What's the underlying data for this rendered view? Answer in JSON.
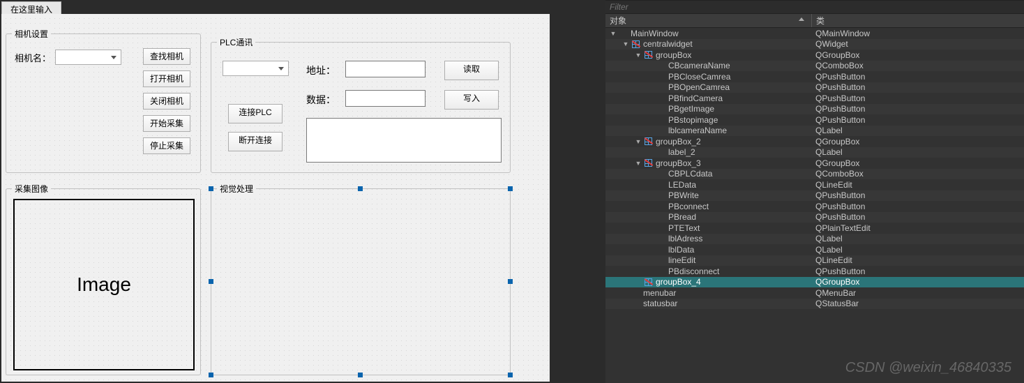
{
  "designer": {
    "tab_title": "在这里输入",
    "camera_group": {
      "title": "相机设置",
      "camera_name_label": "相机名：",
      "buttons": {
        "find": "查找相机",
        "open": "打开相机",
        "close": "关闭相机",
        "start": "开始采集",
        "stop": "停止采集"
      }
    },
    "plc_group": {
      "title": "PLC通讯",
      "connect": "连接PLC",
      "disconnect": "断开连接",
      "address_label": "地址：",
      "data_label": "数据：",
      "read": "读取",
      "write": "写入"
    },
    "image_group": {
      "title": "采集图像",
      "placeholder_text": "Image"
    },
    "vision_group": {
      "title": "视觉处理"
    }
  },
  "inspector": {
    "filter_placeholder": "Filter",
    "columns": {
      "object": "对象",
      "class": "类"
    },
    "tree": [
      {
        "depth": 0,
        "toggle": "▼",
        "icon": "none",
        "name": "MainWindow",
        "cls": "QMainWindow",
        "alt": false
      },
      {
        "depth": 1,
        "toggle": "▼",
        "icon": "layout-no",
        "name": "centralwidget",
        "cls": "QWidget",
        "alt": true
      },
      {
        "depth": 2,
        "toggle": "▼",
        "icon": "layout-no",
        "name": "groupBox",
        "cls": "QGroupBox",
        "alt": false
      },
      {
        "depth": 3,
        "toggle": "",
        "icon": "none",
        "name": "CBcameraName",
        "cls": "QComboBox",
        "alt": true
      },
      {
        "depth": 3,
        "toggle": "",
        "icon": "none",
        "name": "PBCloseCamrea",
        "cls": "QPushButton",
        "alt": false
      },
      {
        "depth": 3,
        "toggle": "",
        "icon": "none",
        "name": "PBOpenCamrea",
        "cls": "QPushButton",
        "alt": true
      },
      {
        "depth": 3,
        "toggle": "",
        "icon": "none",
        "name": "PBfindCamera",
        "cls": "QPushButton",
        "alt": false
      },
      {
        "depth": 3,
        "toggle": "",
        "icon": "none",
        "name": "PBgetImage",
        "cls": "QPushButton",
        "alt": true
      },
      {
        "depth": 3,
        "toggle": "",
        "icon": "none",
        "name": "PBstopimage",
        "cls": "QPushButton",
        "alt": false
      },
      {
        "depth": 3,
        "toggle": "",
        "icon": "none",
        "name": "lblcameraName",
        "cls": "QLabel",
        "alt": true
      },
      {
        "depth": 2,
        "toggle": "▼",
        "icon": "layout-no",
        "name": "groupBox_2",
        "cls": "QGroupBox",
        "alt": false
      },
      {
        "depth": 3,
        "toggle": "",
        "icon": "none",
        "name": "label_2",
        "cls": "QLabel",
        "alt": true
      },
      {
        "depth": 2,
        "toggle": "▼",
        "icon": "layout-no",
        "name": "groupBox_3",
        "cls": "QGroupBox",
        "alt": false
      },
      {
        "depth": 3,
        "toggle": "",
        "icon": "none",
        "name": "CBPLCdata",
        "cls": "QComboBox",
        "alt": true
      },
      {
        "depth": 3,
        "toggle": "",
        "icon": "none",
        "name": "LEData",
        "cls": "QLineEdit",
        "alt": false
      },
      {
        "depth": 3,
        "toggle": "",
        "icon": "none",
        "name": "PBWrite",
        "cls": "QPushButton",
        "alt": true
      },
      {
        "depth": 3,
        "toggle": "",
        "icon": "none",
        "name": "PBconnect",
        "cls": "QPushButton",
        "alt": false
      },
      {
        "depth": 3,
        "toggle": "",
        "icon": "none",
        "name": "PBread",
        "cls": "QPushButton",
        "alt": true
      },
      {
        "depth": 3,
        "toggle": "",
        "icon": "none",
        "name": "PTEText",
        "cls": "QPlainTextEdit",
        "alt": false
      },
      {
        "depth": 3,
        "toggle": "",
        "icon": "none",
        "name": "lblAdress",
        "cls": "QLabel",
        "alt": true
      },
      {
        "depth": 3,
        "toggle": "",
        "icon": "none",
        "name": "lblData",
        "cls": "QLabel",
        "alt": false
      },
      {
        "depth": 3,
        "toggle": "",
        "icon": "none",
        "name": "lineEdit",
        "cls": "QLineEdit",
        "alt": true
      },
      {
        "depth": 3,
        "toggle": "",
        "icon": "none",
        "name": "PBdisconnect",
        "cls": "QPushButton",
        "alt": false
      },
      {
        "depth": 2,
        "toggle": "",
        "icon": "layout-no",
        "name": "groupBox_4",
        "cls": "QGroupBox",
        "alt": true,
        "selected": true
      },
      {
        "depth": 1,
        "toggle": "",
        "icon": "none",
        "name": "menubar",
        "cls": "QMenuBar",
        "alt": false
      },
      {
        "depth": 1,
        "toggle": "",
        "icon": "none",
        "name": "statusbar",
        "cls": "QStatusBar",
        "alt": true
      }
    ]
  },
  "watermark": "CSDN @weixin_46840335"
}
